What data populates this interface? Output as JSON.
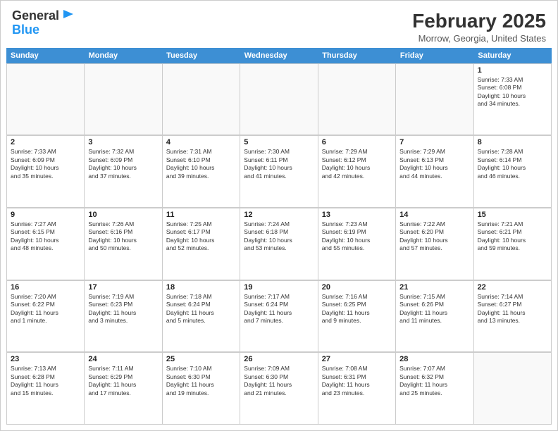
{
  "header": {
    "logo_general": "General",
    "logo_blue": "Blue",
    "month_title": "February 2025",
    "subtitle": "Morrow, Georgia, United States"
  },
  "calendar": {
    "days_of_week": [
      "Sunday",
      "Monday",
      "Tuesday",
      "Wednesday",
      "Thursday",
      "Friday",
      "Saturday"
    ],
    "rows": [
      [
        {
          "day": "",
          "info": "",
          "empty": true
        },
        {
          "day": "",
          "info": "",
          "empty": true
        },
        {
          "day": "",
          "info": "",
          "empty": true
        },
        {
          "day": "",
          "info": "",
          "empty": true
        },
        {
          "day": "",
          "info": "",
          "empty": true
        },
        {
          "day": "",
          "info": "",
          "empty": true
        },
        {
          "day": "1",
          "info": "Sunrise: 7:33 AM\nSunset: 6:08 PM\nDaylight: 10 hours\nand 34 minutes."
        }
      ],
      [
        {
          "day": "2",
          "info": "Sunrise: 7:33 AM\nSunset: 6:09 PM\nDaylight: 10 hours\nand 35 minutes."
        },
        {
          "day": "3",
          "info": "Sunrise: 7:32 AM\nSunset: 6:09 PM\nDaylight: 10 hours\nand 37 minutes."
        },
        {
          "day": "4",
          "info": "Sunrise: 7:31 AM\nSunset: 6:10 PM\nDaylight: 10 hours\nand 39 minutes."
        },
        {
          "day": "5",
          "info": "Sunrise: 7:30 AM\nSunset: 6:11 PM\nDaylight: 10 hours\nand 41 minutes."
        },
        {
          "day": "6",
          "info": "Sunrise: 7:29 AM\nSunset: 6:12 PM\nDaylight: 10 hours\nand 42 minutes."
        },
        {
          "day": "7",
          "info": "Sunrise: 7:29 AM\nSunset: 6:13 PM\nDaylight: 10 hours\nand 44 minutes."
        },
        {
          "day": "8",
          "info": "Sunrise: 7:28 AM\nSunset: 6:14 PM\nDaylight: 10 hours\nand 46 minutes."
        }
      ],
      [
        {
          "day": "9",
          "info": "Sunrise: 7:27 AM\nSunset: 6:15 PM\nDaylight: 10 hours\nand 48 minutes."
        },
        {
          "day": "10",
          "info": "Sunrise: 7:26 AM\nSunset: 6:16 PM\nDaylight: 10 hours\nand 50 minutes."
        },
        {
          "day": "11",
          "info": "Sunrise: 7:25 AM\nSunset: 6:17 PM\nDaylight: 10 hours\nand 52 minutes."
        },
        {
          "day": "12",
          "info": "Sunrise: 7:24 AM\nSunset: 6:18 PM\nDaylight: 10 hours\nand 53 minutes."
        },
        {
          "day": "13",
          "info": "Sunrise: 7:23 AM\nSunset: 6:19 PM\nDaylight: 10 hours\nand 55 minutes."
        },
        {
          "day": "14",
          "info": "Sunrise: 7:22 AM\nSunset: 6:20 PM\nDaylight: 10 hours\nand 57 minutes."
        },
        {
          "day": "15",
          "info": "Sunrise: 7:21 AM\nSunset: 6:21 PM\nDaylight: 10 hours\nand 59 minutes."
        }
      ],
      [
        {
          "day": "16",
          "info": "Sunrise: 7:20 AM\nSunset: 6:22 PM\nDaylight: 11 hours\nand 1 minute."
        },
        {
          "day": "17",
          "info": "Sunrise: 7:19 AM\nSunset: 6:23 PM\nDaylight: 11 hours\nand 3 minutes."
        },
        {
          "day": "18",
          "info": "Sunrise: 7:18 AM\nSunset: 6:24 PM\nDaylight: 11 hours\nand 5 minutes."
        },
        {
          "day": "19",
          "info": "Sunrise: 7:17 AM\nSunset: 6:24 PM\nDaylight: 11 hours\nand 7 minutes."
        },
        {
          "day": "20",
          "info": "Sunrise: 7:16 AM\nSunset: 6:25 PM\nDaylight: 11 hours\nand 9 minutes."
        },
        {
          "day": "21",
          "info": "Sunrise: 7:15 AM\nSunset: 6:26 PM\nDaylight: 11 hours\nand 11 minutes."
        },
        {
          "day": "22",
          "info": "Sunrise: 7:14 AM\nSunset: 6:27 PM\nDaylight: 11 hours\nand 13 minutes."
        }
      ],
      [
        {
          "day": "23",
          "info": "Sunrise: 7:13 AM\nSunset: 6:28 PM\nDaylight: 11 hours\nand 15 minutes."
        },
        {
          "day": "24",
          "info": "Sunrise: 7:11 AM\nSunset: 6:29 PM\nDaylight: 11 hours\nand 17 minutes."
        },
        {
          "day": "25",
          "info": "Sunrise: 7:10 AM\nSunset: 6:30 PM\nDaylight: 11 hours\nand 19 minutes."
        },
        {
          "day": "26",
          "info": "Sunrise: 7:09 AM\nSunset: 6:30 PM\nDaylight: 11 hours\nand 21 minutes."
        },
        {
          "day": "27",
          "info": "Sunrise: 7:08 AM\nSunset: 6:31 PM\nDaylight: 11 hours\nand 23 minutes."
        },
        {
          "day": "28",
          "info": "Sunrise: 7:07 AM\nSunset: 6:32 PM\nDaylight: 11 hours\nand 25 minutes."
        },
        {
          "day": "",
          "info": "",
          "empty": true
        }
      ]
    ]
  }
}
